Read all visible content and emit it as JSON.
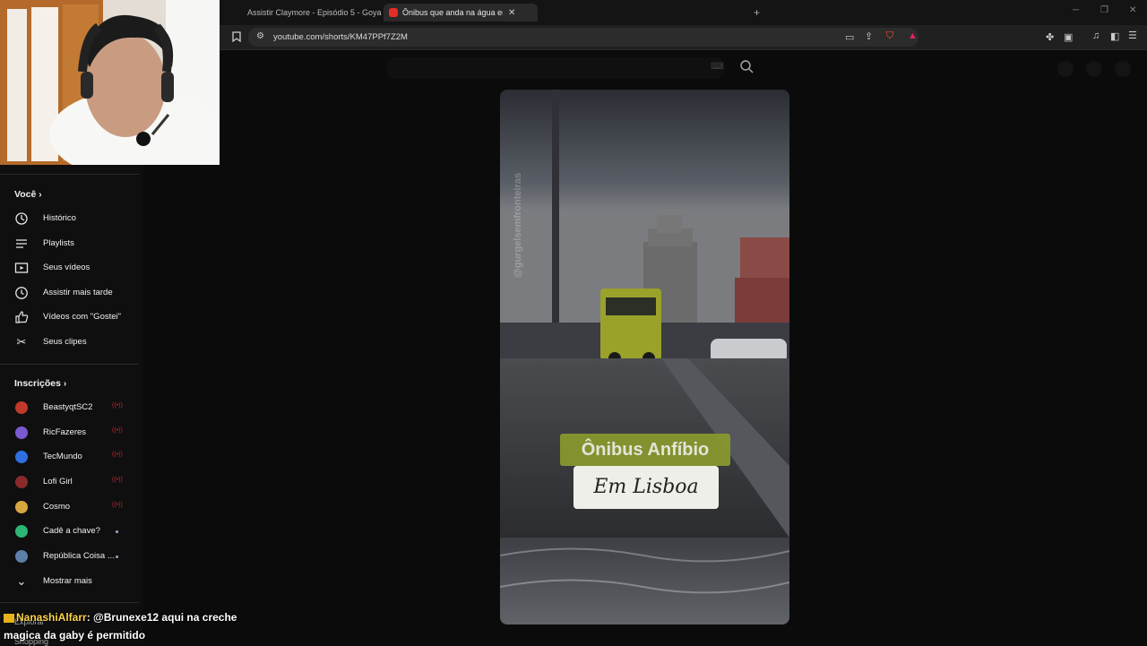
{
  "browser": {
    "tabs": [
      {
        "label": "Assistir Claymore - Episódio 5 - Goya",
        "active": false
      },
      {
        "label": "Ônibus que anda na água em",
        "active": true
      }
    ],
    "url": "youtube.com/shorts/KM47PPf7Z2M"
  },
  "sidebar": {
    "you_section": {
      "title": "Você",
      "items": [
        {
          "label": "Histórico",
          "icon": "history-icon"
        },
        {
          "label": "Playlists",
          "icon": "playlists-icon"
        },
        {
          "label": "Seus vídeos",
          "icon": "your-videos-icon"
        },
        {
          "label": "Assistir mais tarde",
          "icon": "watch-later-icon"
        },
        {
          "label": "Vídeos com \"Gostei\"",
          "icon": "thumbs-up-icon"
        },
        {
          "label": "Seus clipes",
          "icon": "scissors-icon"
        }
      ]
    },
    "subs_section": {
      "title": "Inscrições",
      "items": [
        {
          "label": "BeastyqtSC2",
          "status": "live",
          "avatar_color": "#c0392b"
        },
        {
          "label": "RicFazeres",
          "status": "live",
          "avatar_color": "#7a5ad0"
        },
        {
          "label": "TecMundo",
          "status": "live",
          "avatar_color": "#2f6fe0"
        },
        {
          "label": "Lofi Girl",
          "status": "live",
          "avatar_color": "#8b2a2a"
        },
        {
          "label": "Cosmo",
          "status": "live",
          "avatar_color": "#d6a640"
        },
        {
          "label": "Cadê a chave?",
          "status": "new",
          "avatar_color": "#2bb673"
        },
        {
          "label": "República Coisa ...",
          "status": "new",
          "avatar_color": "#5d7fa8"
        }
      ],
      "show_more": "Mostrar mais"
    },
    "explore_label": "Explorar",
    "shopping_label": "Shopping"
  },
  "video": {
    "title_overlay": "Ônibus Anfíbio",
    "subtitle_overlay": "Em Lisboa",
    "watermark": "@gurgelsemfronteiras"
  },
  "chat": {
    "username": "NanashiAlfarr",
    "message": ": @Brunexe12 aqui na creche magica da gaby é permitido"
  },
  "colors": {
    "accent": "#ff0000",
    "live": "#cc2233",
    "overlay_green": "#8a9a2e"
  }
}
